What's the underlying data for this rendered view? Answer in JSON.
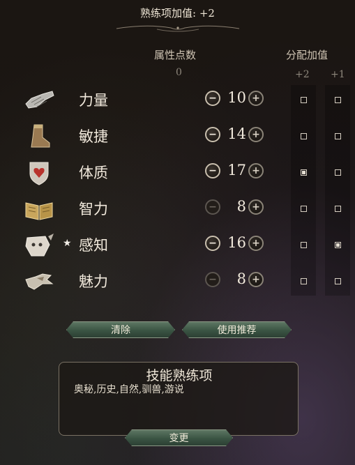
{
  "header": {
    "title": "熟练项加值: +2"
  },
  "columns": {
    "attribute_points_label": "属性点数",
    "points": "0",
    "bonus_label": "分配加值",
    "bonus_plus2": "+2",
    "bonus_plus1": "+1"
  },
  "attributes": [
    {
      "name": "力量",
      "value": "10",
      "icon": "gauntlet-icon",
      "minus_enabled": true,
      "plus2": false,
      "plus1": false,
      "star": ""
    },
    {
      "name": "敏捷",
      "value": "14",
      "icon": "boot-icon",
      "minus_enabled": true,
      "plus2": false,
      "plus1": false,
      "star": ""
    },
    {
      "name": "体质",
      "value": "17",
      "icon": "heart-shield-icon",
      "minus_enabled": true,
      "plus2": true,
      "plus1": false,
      "star": ""
    },
    {
      "name": "智力",
      "value": "8",
      "icon": "open-book-icon",
      "minus_enabled": false,
      "plus2": false,
      "plus1": false,
      "star": ""
    },
    {
      "name": "感知",
      "value": "16",
      "icon": "eye-mask-icon",
      "minus_enabled": true,
      "plus2": false,
      "plus1": true,
      "star": "★"
    },
    {
      "name": "魅力",
      "value": "8",
      "icon": "bird-hand-icon",
      "minus_enabled": false,
      "plus2": false,
      "plus1": false,
      "star": ""
    }
  ],
  "buttons": {
    "clear": "清除",
    "recommend": "使用推荐",
    "change": "变更"
  },
  "skills": {
    "title": "技能熟练项",
    "list": "奥秘,历史,自然,驯兽,游说"
  },
  "glyphs": {
    "minus": "−",
    "plus": "+"
  },
  "colors": {
    "button_green": "#3a5443",
    "text": "#e6dccb"
  }
}
